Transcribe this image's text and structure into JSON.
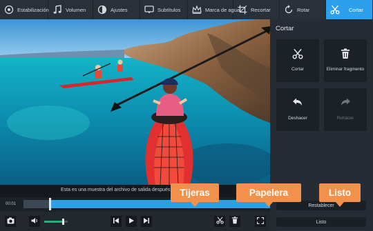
{
  "toolbar": {
    "tools": [
      {
        "label": "Estabilización",
        "icon": "stabilization-icon"
      },
      {
        "label": "Volumen",
        "icon": "music-note-icon"
      },
      {
        "label": "Ajustes",
        "icon": "contrast-icon"
      },
      {
        "label": "Subtítulos",
        "icon": "subtitles-icon"
      },
      {
        "label": "Marca de agua",
        "icon": "watermark-icon"
      },
      {
        "label": "Recortar",
        "icon": "crop-icon"
      },
      {
        "label": "Rotar",
        "icon": "rotate-icon"
      },
      {
        "label": "Cortar",
        "icon": "scissors-icon",
        "active": true
      }
    ]
  },
  "panel": {
    "title": "Cortar",
    "buttons": {
      "cut": "Cortar",
      "delete": "Eliminar fragmento",
      "undo": "Deshacer",
      "redo": "Rehacer"
    },
    "reset": "Restablecer",
    "done": "Listo"
  },
  "video": {
    "subtitle": "Esta es una muestra del archivo de salida después"
  },
  "timeline": {
    "time": "00:01",
    "progress_fraction": 0.11
  },
  "volume": {
    "level_fraction": 0.8
  },
  "callouts": {
    "scissors": "Tijeras",
    "trash": "Papelera",
    "done": "Listo"
  },
  "colors": {
    "accent": "#2ca0ec",
    "callout": "#f2914b",
    "volume": "#22b07d"
  }
}
